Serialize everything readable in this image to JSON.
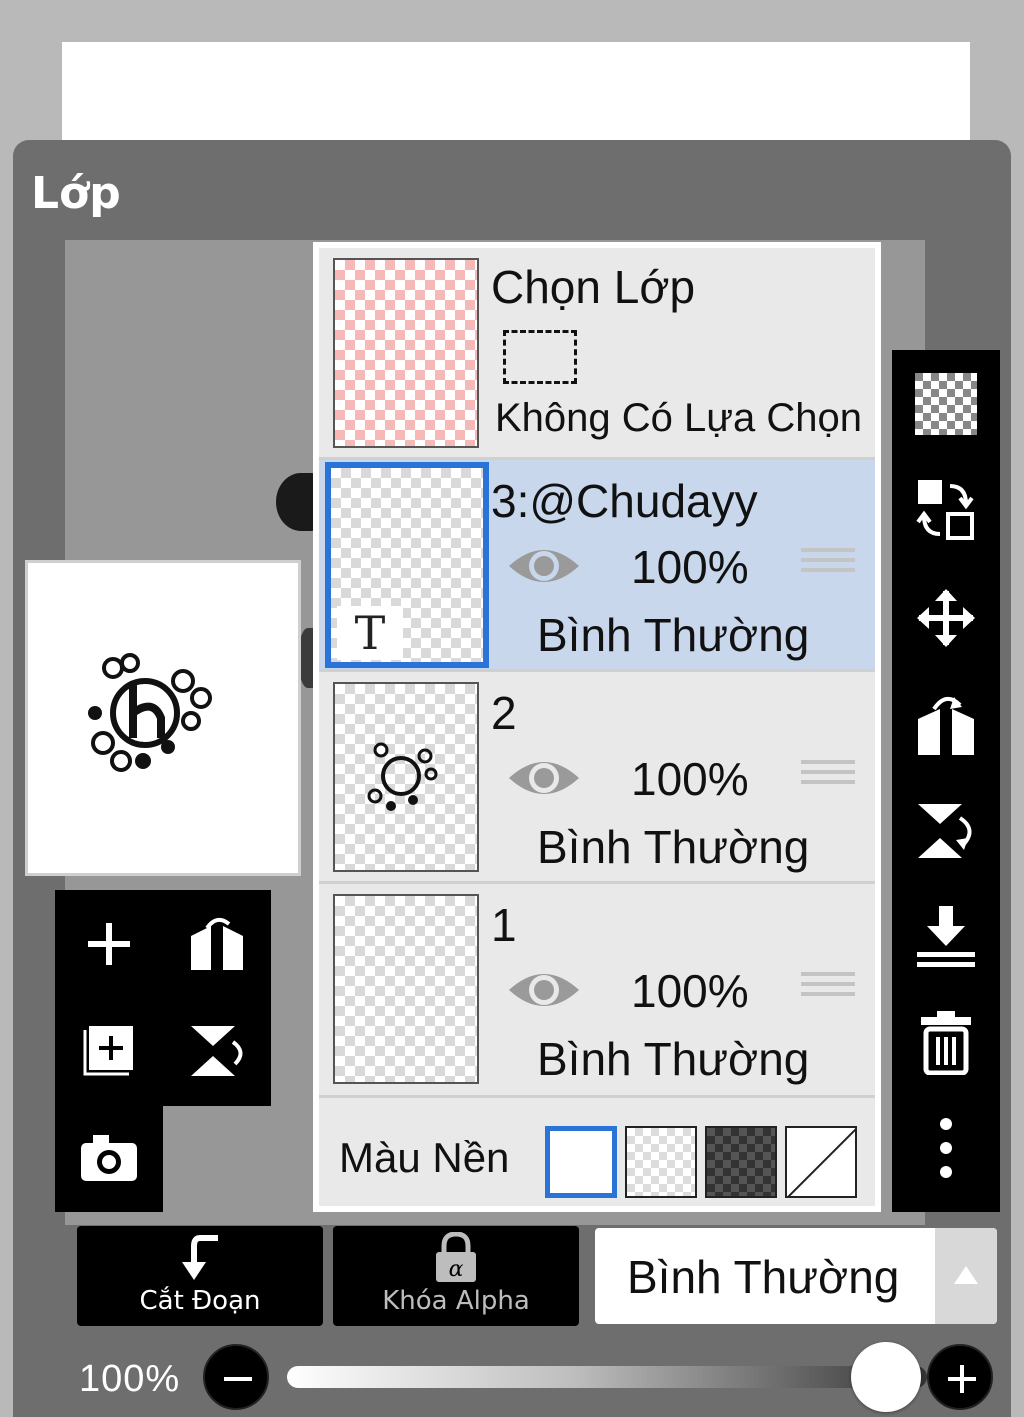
{
  "panel": {
    "title": "Lớp"
  },
  "selection_row": {
    "title": "Chọn Lớp",
    "subtitle": "Không Có Lựa Chọn"
  },
  "layers": [
    {
      "name": "3:@Chudayy",
      "opacity": "100%",
      "blend": "Bình Thường",
      "selected": true,
      "thumb_mark": "T"
    },
    {
      "name": "2",
      "opacity": "100%",
      "blend": "Bình Thường",
      "selected": false
    },
    {
      "name": "1",
      "opacity": "100%",
      "blend": "Bình Thường",
      "selected": false
    }
  ],
  "background": {
    "label": "Màu Nền",
    "options": [
      "white",
      "light-checker",
      "dark-checker",
      "none"
    ],
    "selected": "white"
  },
  "right_toolbar": [
    "checker-icon",
    "swap-layer-icon",
    "move-icon",
    "flip-horizontal-icon",
    "flip-vertical-icon",
    "merge-down-icon",
    "trash-icon",
    "more-icon"
  ],
  "left_tools": [
    "add-layer-icon",
    "flip-horizontal-icon",
    "add-copy-layer-icon",
    "flip-vertical-icon",
    "camera-icon"
  ],
  "bottom": {
    "clip_label": "Cắt Đoạn",
    "alpha_lock_label": "Khóa Alpha",
    "blend_mode": "Bình Thường"
  },
  "opacity": {
    "label": "100%",
    "value": 1.0
  },
  "colors": {
    "accent": "#2a74d8",
    "panel": "#6e6e6e",
    "toolbar": "#000000",
    "selected_row": "#c8d7ec"
  }
}
